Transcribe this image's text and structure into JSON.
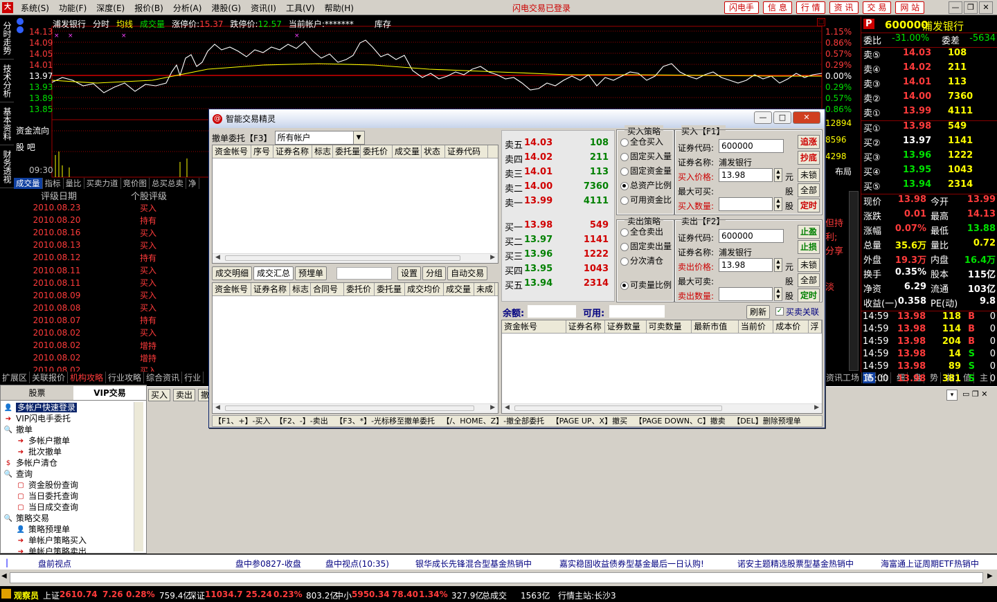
{
  "menu": {
    "items": [
      "系统(S)",
      "功能(F)",
      "深度(E)",
      "报价(B)",
      "分析(A)",
      "港股(G)",
      "资讯(I)",
      "工具(V)",
      "帮助(H)"
    ],
    "status": "闪电交易已登录",
    "top_buttons": [
      "闪电手",
      "信 息",
      "行 情",
      "资 讯",
      "交 易",
      "网 站"
    ]
  },
  "side_tabs": [
    "分时走势",
    "技术分析",
    "基本资料",
    "财务透视"
  ],
  "chart": {
    "stock": "浦发银行",
    "mode1": "分时",
    "mode2": "均线",
    "mode3": "成交量",
    "limit_up_label": "涨停价:",
    "limit_up": "15.37",
    "limit_down_label": "跌停价:",
    "limit_down": "12.57",
    "account_label": "当前帐户:",
    "account": "*******",
    "stock_tab": "库存",
    "price_left": [
      "14.13",
      "14.09",
      "14.05",
      "14.01",
      "13.97",
      "13.93",
      "13.89",
      "13.85"
    ],
    "pct_right": [
      "1.15%",
      "0.86%",
      "0.57%",
      "0.29%",
      "0.00%",
      "0.29%",
      "0.57%",
      "0.86%"
    ],
    "vol_right": [
      "12894",
      "8596",
      "4298"
    ],
    "fund_flow": "资金流向",
    "fund_sub": "股  吧",
    "time_label": "09:30",
    "layout_label": "布局",
    "tabs": [
      "成交量",
      "指标",
      "量比",
      "买卖力道",
      "竞价图",
      "总买总卖",
      "净"
    ]
  },
  "rating": {
    "col1": "评级日期",
    "col2": "个股评级",
    "rows": [
      [
        "2010.08.23",
        "买入"
      ],
      [
        "2010.08.20",
        "持有"
      ],
      [
        "2010.08.16",
        "买入"
      ],
      [
        "2010.08.13",
        "买入"
      ],
      [
        "2010.08.12",
        "持有"
      ],
      [
        "2010.08.11",
        "买入"
      ],
      [
        "2010.08.11",
        "买入"
      ],
      [
        "2010.08.09",
        "买入"
      ],
      [
        "2010.08.08",
        "买入"
      ],
      [
        "2010.08.07",
        "持有"
      ],
      [
        "2010.08.02",
        "买入"
      ],
      [
        "2010.08.02",
        "增持"
      ],
      [
        "2010.08.02",
        "增持"
      ],
      [
        "2010.08.02",
        "买入"
      ]
    ]
  },
  "info_tabs": [
    "扩展区",
    "关联报价",
    "机构攻略",
    "行业攻略",
    "综合资讯",
    "行业"
  ],
  "right_tabs": [
    "资讯工场",
    "笔",
    "价",
    "细",
    "盘",
    "势",
    "指",
    "值",
    "主"
  ],
  "quote": {
    "code": "600000",
    "name": "浦发银行",
    "ratio_label": "委比",
    "ratio": "-31.00%",
    "diff_label": "委差",
    "diff": "-5634",
    "sells": [
      [
        "卖⑤",
        "14.03",
        "108"
      ],
      [
        "卖④",
        "14.02",
        "211"
      ],
      [
        "卖③",
        "14.01",
        "113"
      ],
      [
        "卖②",
        "14.00",
        "7360"
      ],
      [
        "卖①",
        "13.99",
        "4111"
      ]
    ],
    "buys": [
      [
        "买①",
        "13.98",
        "549"
      ],
      [
        "买②",
        "13.97",
        "1141"
      ],
      [
        "买③",
        "13.96",
        "1222"
      ],
      [
        "买④",
        "13.95",
        "1043"
      ],
      [
        "买⑤",
        "13.94",
        "2314"
      ]
    ],
    "stats": [
      [
        "现价",
        "13.98",
        "今开",
        "13.99"
      ],
      [
        "涨跌",
        "0.01",
        "最高",
        "14.13"
      ],
      [
        "涨幅",
        "0.07%",
        "最低",
        "13.88"
      ],
      [
        "总量",
        "35.6万",
        "量比",
        "0.72"
      ],
      [
        "外盘",
        "19.3万",
        "内盘",
        "16.4万"
      ],
      [
        "换手",
        "0.35%",
        "股本",
        "115亿"
      ],
      [
        "净资",
        "6.29",
        "流通",
        "103亿"
      ],
      [
        "收益(一)",
        "0.358",
        "PE(动)",
        "9.8"
      ]
    ],
    "ticks": [
      [
        "14:59",
        "13.98",
        "118",
        "B",
        "0"
      ],
      [
        "14:59",
        "13.98",
        "114",
        "B",
        "0"
      ],
      [
        "14:59",
        "13.98",
        "204",
        "B",
        "0"
      ],
      [
        "14:59",
        "13.98",
        "14",
        "S",
        "0"
      ],
      [
        "14:59",
        "13.98",
        "89",
        "S",
        "0"
      ],
      [
        "15:00",
        "13.98",
        "381",
        "S",
        "0"
      ]
    ]
  },
  "peek_right": [
    "但持",
    "利;",
    "分享",
    "淡"
  ],
  "left_panel": {
    "tabs": [
      "股票",
      "VIP交易"
    ],
    "tree": [
      "多帐户快速登录",
      "VIP闪电手委托",
      "撤单",
      "多帐户撤单",
      "批次撤单",
      "多帐户清仓",
      "查询",
      "资金股份查询",
      "当日委托查询",
      "当日成交查询",
      "策略交易",
      "策略预埋单",
      "单帐户策略买入",
      "单帐户策略卖出"
    ]
  },
  "trade_bar": [
    "买入",
    "卖出",
    "撤"
  ],
  "dialog": {
    "title": "智能交易精灵",
    "cancel_label": "撤单委托【F3】",
    "account_select": "所有帐户",
    "order_cols": [
      "资金帐号",
      "序号",
      "证券名称",
      "标志",
      "委托量",
      "委托价",
      "成交量",
      "状态",
      "证券代码"
    ],
    "sub_tabs": [
      "成交明细",
      "成交汇总",
      "预埋单"
    ],
    "sub_btns": [
      "设置",
      "分组",
      "自动交易"
    ],
    "deal_cols": [
      "资金帐号",
      "证券名称",
      "标志",
      "合同号",
      "委托价",
      "委托量",
      "成交均价",
      "成交量",
      "未成"
    ],
    "q_sells": [
      [
        "卖五",
        "14.03",
        "108"
      ],
      [
        "卖四",
        "14.02",
        "211"
      ],
      [
        "卖三",
        "14.01",
        "113"
      ],
      [
        "卖二",
        "14.00",
        "7360"
      ],
      [
        "卖一",
        "13.99",
        "4111"
      ]
    ],
    "q_buys": [
      [
        "买一",
        "13.98",
        "549"
      ],
      [
        "买二",
        "13.97",
        "1141"
      ],
      [
        "买三",
        "13.96",
        "1222"
      ],
      [
        "买四",
        "13.95",
        "1043"
      ],
      [
        "买五",
        "13.94",
        "2314"
      ]
    ],
    "buy_strategy_title": "买入策略",
    "buy_strategies": [
      "全仓买入",
      "固定买入量",
      "固定资金量",
      "总资产比例",
      "可用资金比"
    ],
    "sell_strategy_title": "卖出策略",
    "sell_strategies": [
      "全仓卖出",
      "固定卖出量",
      "分次清仓",
      "可卖量比例"
    ],
    "buy_title": "买入【F1】",
    "sell_title": "卖出【F2】",
    "code_label": "证券代码:",
    "name_label": "证券名称:",
    "code": "600000",
    "name": "浦发银行",
    "buy_price_label": "买入价格:",
    "buy_price": "13.98",
    "yuan": "元",
    "max_buy_label": "最大可买:",
    "stock_unit": "股",
    "buy_qty_label": "买入数量:",
    "sell_price_label": "卖出价格:",
    "sell_price": "13.98",
    "max_sell_label": "最大可卖:",
    "sell_qty_label": "卖出数量:",
    "btn_chase": "追涨",
    "btn_bottom": "抄底",
    "btn_unlock": "未锁",
    "btn_all": "全部",
    "btn_timer": "定时",
    "btn_profit": "止盈",
    "btn_loss": "止损",
    "balance_label": "余额:",
    "avail_label": "可用:",
    "refresh": "刷新",
    "link_label": "买卖关联",
    "hold_cols": [
      "资金帐号",
      "证券名称",
      "证券数量",
      "可卖数量",
      "最新市值",
      "当前价",
      "成本价",
      "浮"
    ],
    "hotkeys": "【F1、+】-买入  【F2、-】-卖出   【F3、*】-光标移至撤单委托   【/、HOME、Z】-撤全部委托   【PAGE UP、X】撤买   【PAGE DOWN、C】撤卖   【DEL】删除预埋单"
  },
  "ticker": [
    "盘前视点",
    "盘中参0827-收盘",
    "盘中视点(10:35)",
    "银华成长先锋混合型基金热销中",
    "嘉实稳固收益债券型基金最后一日认购!",
    "诺安主题精选股票型基金热销中",
    "海富通上证周期ETF热销中"
  ],
  "statusbar": {
    "user": "观察员",
    "sh_label": "上证",
    "sh": "2610.74",
    "sh_chg": "7.26",
    "sh_pct": "0.28%",
    "sh_amt": "759.4亿",
    "sz_label": "深证",
    "sz": "11034.7",
    "sz_chg": "25.24",
    "sz_pct": "0.23%",
    "sz_amt": "803.2亿",
    "zx_label": "中小",
    "zx": "5950.34",
    "zx_chg": "78.40",
    "zx_pct": "1.34%",
    "zx_amt": "327.9亿",
    "total_label": "总成交",
    "total": "1563亿",
    "server": "行情主站:长沙3"
  }
}
